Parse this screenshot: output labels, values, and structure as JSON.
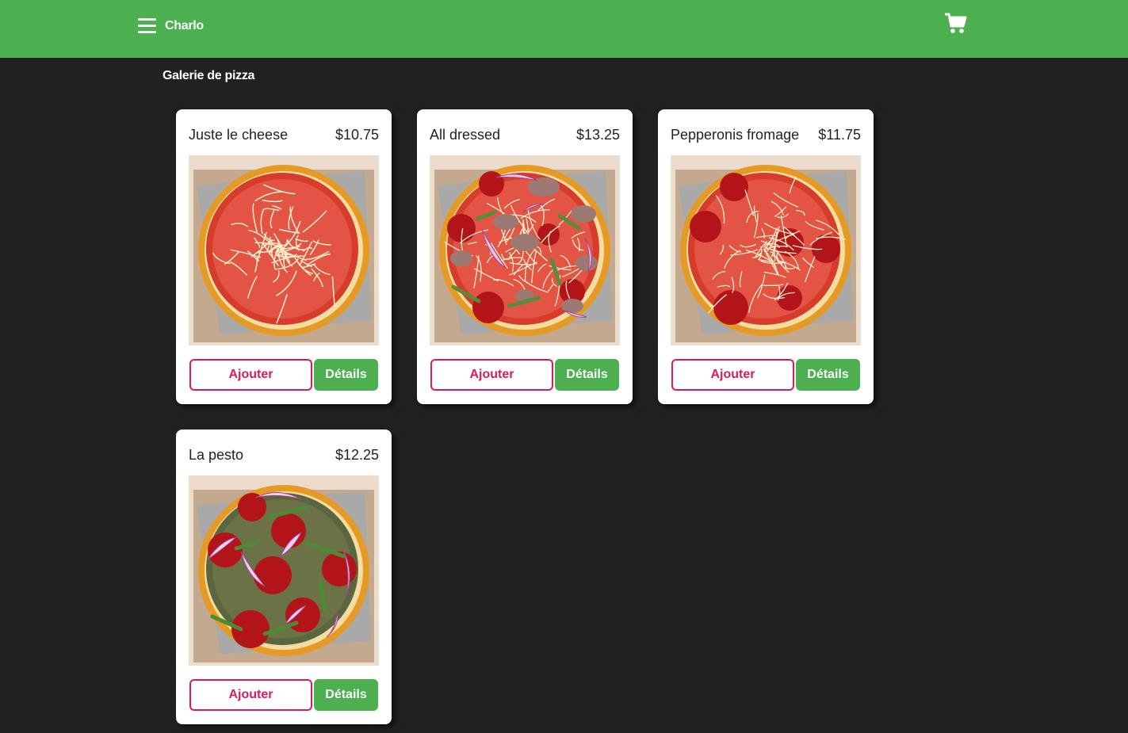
{
  "header": {
    "brand": "Charlo",
    "menu_icon": "hamburger-menu-icon",
    "cart_icon": "shopping-cart-icon"
  },
  "gallery": {
    "title": "Galerie de pizza"
  },
  "pizzas": [
    {
      "name": "Juste le cheese",
      "price": "$10.75",
      "add_label": "Ajouter",
      "details_label": "Détails"
    },
    {
      "name": "All dressed",
      "price": "$13.25",
      "add_label": "Ajouter",
      "details_label": "Détails"
    },
    {
      "name": "Pepperonis fromage",
      "price": "$11.75",
      "add_label": "Ajouter",
      "details_label": "Détails"
    },
    {
      "name": "La pesto",
      "price": "$12.25",
      "add_label": "Ajouter",
      "details_label": "Détails"
    }
  ],
  "colors": {
    "header": "#4caf50",
    "background": "#212121",
    "accent": "#d81b60"
  }
}
